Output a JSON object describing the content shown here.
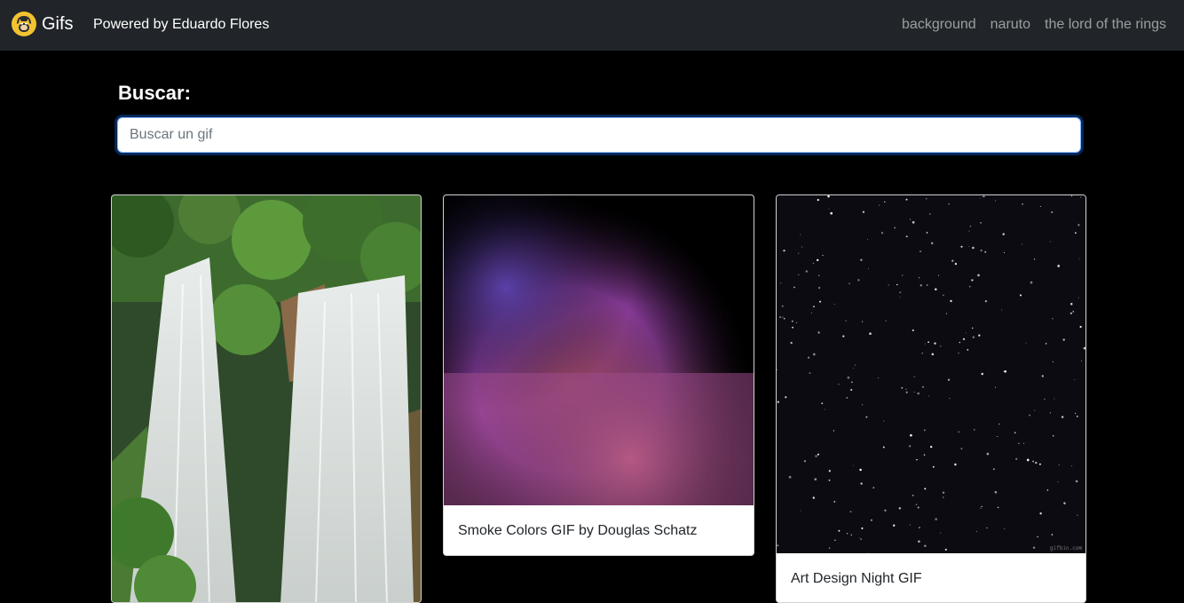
{
  "navbar": {
    "brand": "Gifs",
    "powered_by": "Powered by Eduardo Flores",
    "links": [
      "background",
      "naruto",
      "the lord of the rings"
    ]
  },
  "search": {
    "label": "Buscar:",
    "placeholder": "Buscar un gif",
    "value": ""
  },
  "cards": [
    {
      "title": "",
      "image": "waterfall-gif"
    },
    {
      "title": "Smoke Colors GIF by Douglas Schatz",
      "image": "purple-smoke-gif"
    },
    {
      "title": "Art Design Night GIF",
      "image": "night-stars-gif",
      "watermark": "gifbin.com"
    }
  ],
  "colors": {
    "navbar_bg": "#212529",
    "page_bg": "#000000",
    "focus_ring": "#86b7fe"
  }
}
